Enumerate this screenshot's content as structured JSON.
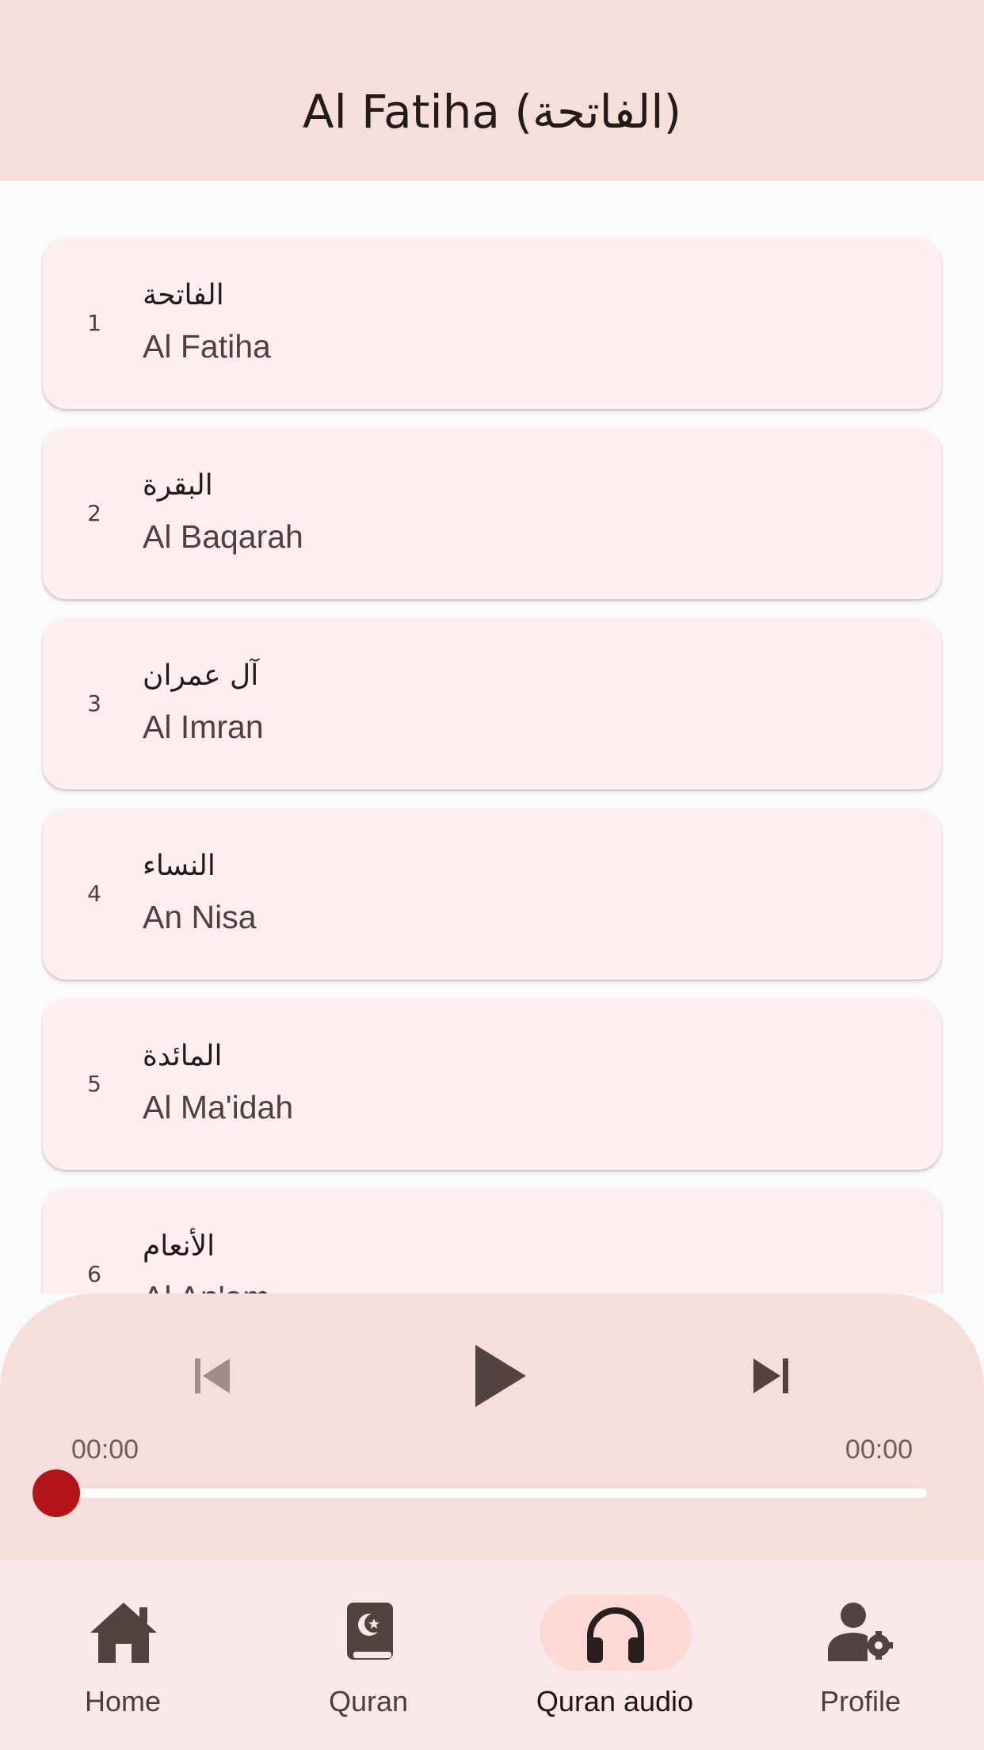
{
  "app_bar": {
    "title": "Al Fatiha (الفاتحة)"
  },
  "surahs": [
    {
      "number": "1",
      "arabic": "الفاتحة",
      "english": "Al Fatiha"
    },
    {
      "number": "2",
      "arabic": "البقرة",
      "english": "Al Baqarah"
    },
    {
      "number": "3",
      "arabic": "آل عمران",
      "english": "Al Imran"
    },
    {
      "number": "4",
      "arabic": "النساء",
      "english": "An Nisa"
    },
    {
      "number": "5",
      "arabic": "المائدة",
      "english": "Al Ma'idah"
    },
    {
      "number": "6",
      "arabic": "الأنعام",
      "english": "Al An'am"
    }
  ],
  "player": {
    "elapsed": "00:00",
    "duration": "00:00",
    "progress": 0,
    "prev_icon": "skip-previous-icon",
    "play_icon": "play-icon",
    "next_icon": "skip-next-icon"
  },
  "bottom_nav": {
    "items": [
      {
        "label": "Home",
        "icon": "home-icon",
        "active": false
      },
      {
        "label": "Quran",
        "icon": "quran-book-icon",
        "active": false
      },
      {
        "label": "Quran audio",
        "icon": "headphones-icon",
        "active": true
      },
      {
        "label": "Profile",
        "icon": "user-settings-icon",
        "active": false
      }
    ]
  },
  "colors": {
    "app_bar_bg": "#F6DEDB",
    "card_bg": "#FCEEF1",
    "accent_thumb": "#B41518",
    "nav_active_pill": "#FFD9D4"
  }
}
